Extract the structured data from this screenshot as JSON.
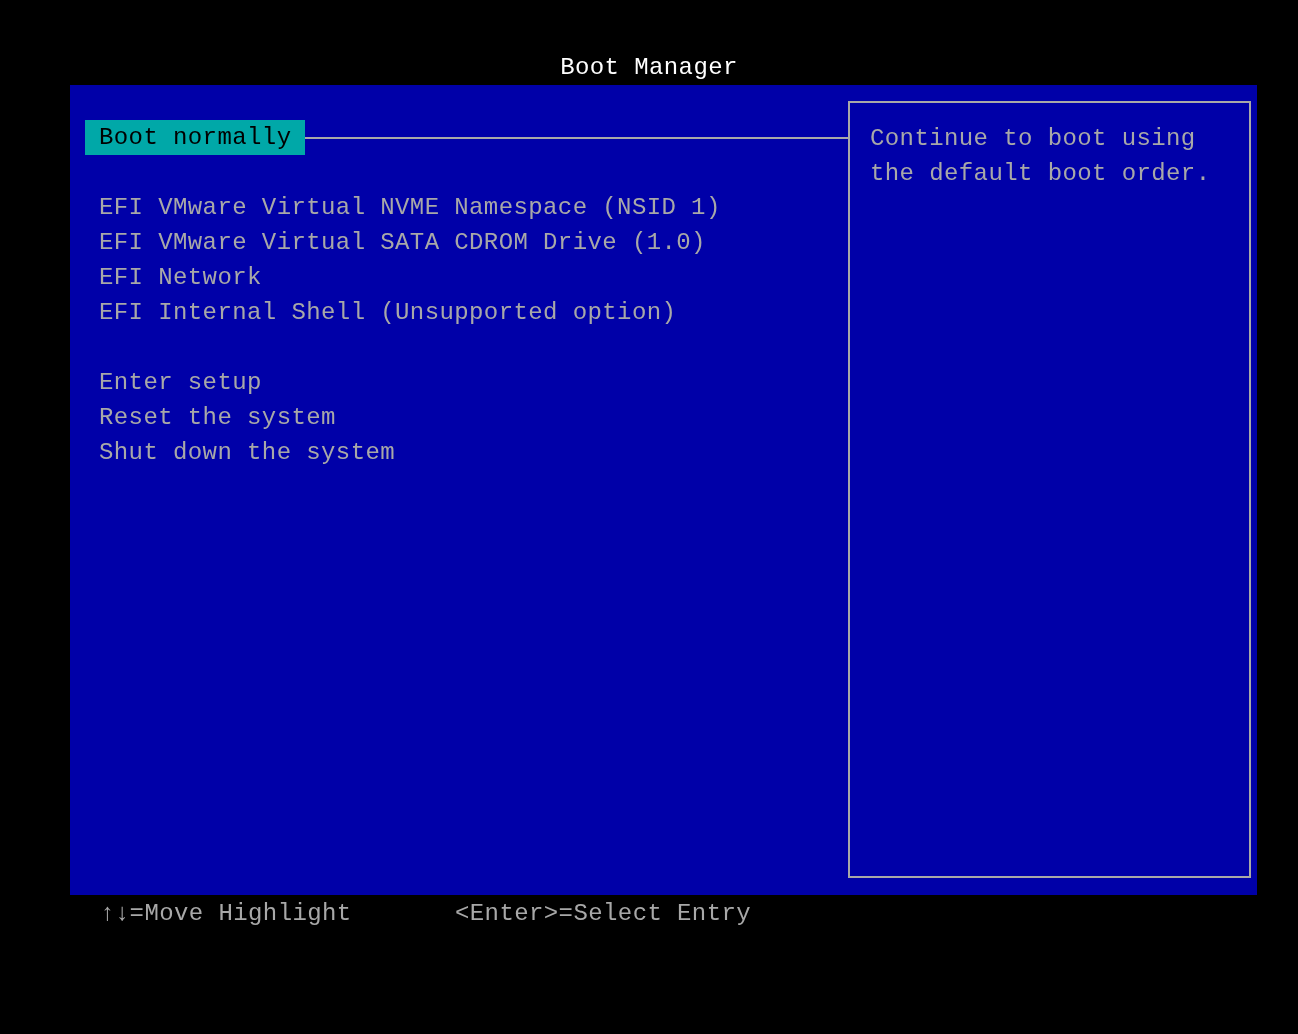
{
  "window": {
    "title": "Boot Manager"
  },
  "menu": {
    "groups": [
      [
        {
          "label": "Boot normally",
          "selected": true
        }
      ],
      [
        {
          "label": "EFI VMware Virtual NVME Namespace (NSID 1)",
          "selected": false
        },
        {
          "label": "EFI VMware Virtual SATA CDROM Drive (1.0)",
          "selected": false
        },
        {
          "label": "EFI Network",
          "selected": false
        },
        {
          "label": "EFI Internal Shell (Unsupported option)",
          "selected": false
        }
      ],
      [
        {
          "label": "Enter setup",
          "selected": false
        },
        {
          "label": "Reset the system",
          "selected": false
        },
        {
          "label": "Shut down the system",
          "selected": false
        }
      ]
    ]
  },
  "help": {
    "text": "Continue to boot using the default boot order."
  },
  "footer": {
    "hints": [
      "↑↓=Move Highlight",
      "<Enter>=Select Entry"
    ]
  }
}
